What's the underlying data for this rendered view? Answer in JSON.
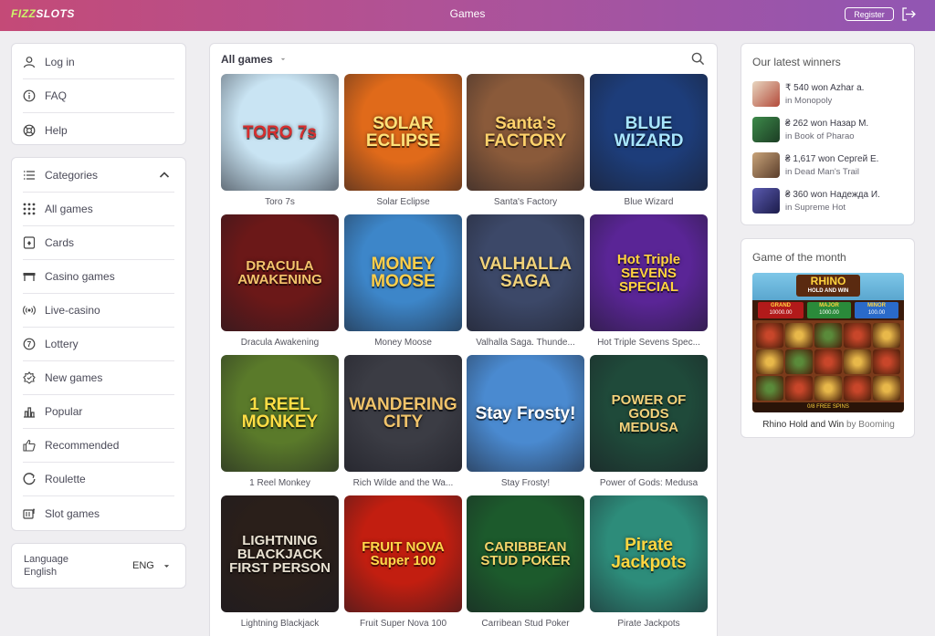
{
  "header": {
    "logo_part1": "FIZZ",
    "logo_part2": "SLOTS",
    "title": "Games",
    "register_label": "Register",
    "exit_icon": "exit-icon"
  },
  "account_menu": [
    {
      "label": "Log in",
      "icon": "user-icon"
    },
    {
      "label": "FAQ",
      "icon": "info-icon"
    },
    {
      "label": "Help",
      "icon": "lifebuoy-icon"
    }
  ],
  "categories": {
    "header": "Categories",
    "items": [
      {
        "label": "All games",
        "icon": "grid-icon"
      },
      {
        "label": "Cards",
        "icon": "card-icon"
      },
      {
        "label": "Casino games",
        "icon": "table-icon"
      },
      {
        "label": "Live-casino",
        "icon": "broadcast-icon"
      },
      {
        "label": "Lottery",
        "icon": "lottery-icon"
      },
      {
        "label": "New games",
        "icon": "badge-icon"
      },
      {
        "label": "Popular",
        "icon": "chart-icon"
      },
      {
        "label": "Recommended",
        "icon": "thumb-up-icon"
      },
      {
        "label": "Roulette",
        "icon": "roulette-icon"
      },
      {
        "label": "Slot games",
        "icon": "slot-icon"
      }
    ]
  },
  "language": {
    "label": "Language",
    "value": "English",
    "code": "ENG"
  },
  "games": {
    "filter_label": "All games",
    "tiles": [
      {
        "name": "Toro 7s",
        "art": "TORO 7s",
        "bg": "#c9e4f3",
        "fg": "#d62e2e"
      },
      {
        "name": "Solar Eclipse",
        "art": "SOLAR ECLIPSE",
        "bg": "#e06a1a",
        "fg": "#ffe27a"
      },
      {
        "name": "Santa's Factory",
        "art": "Santa's FACTORY",
        "bg": "#8a5a3a",
        "fg": "#ffd26b"
      },
      {
        "name": "Blue Wizard",
        "art": "BLUE WIZARD",
        "bg": "#1d3d7a",
        "fg": "#a8e6ff"
      },
      {
        "name": "Dracula Awakening",
        "art": "DRACULA AWAKENING",
        "bg": "#6b1818",
        "fg": "#f3c46c"
      },
      {
        "name": "Money Moose",
        "art": "MONEY MOOSE",
        "bg": "#3d86c9",
        "fg": "#ffcf4a"
      },
      {
        "name": "Valhalla Saga. Thunde...",
        "art": "VALHALLA SAGA",
        "bg": "#3c4868",
        "fg": "#f1d27a"
      },
      {
        "name": "Hot Triple Sevens Spec...",
        "art": "Hot Triple SEVENS SPECIAL",
        "bg": "#5a2596",
        "fg": "#ffd33d"
      },
      {
        "name": "1 Reel Monkey",
        "art": "1 REEL MONKEY",
        "bg": "#5a7a2a",
        "fg": "#ffdd44"
      },
      {
        "name": "Rich Wilde and the Wa...",
        "art": "WANDERING CITY",
        "bg": "#3b3c44",
        "fg": "#f0c36a"
      },
      {
        "name": "Stay Frosty!",
        "art": "Stay Frosty!",
        "bg": "#4a8ad0",
        "fg": "#ffffff"
      },
      {
        "name": "Power of Gods: Medusa",
        "art": "POWER OF GODS MEDUSA",
        "bg": "#1f4a3a",
        "fg": "#f3d07a"
      },
      {
        "name": "Lightning Blackjack",
        "art": "LIGHTNING BLACKJACK FIRST PERSON",
        "bg": "#2a1f1a",
        "fg": "#e9e2d2"
      },
      {
        "name": "Fruit Super Nova 100",
        "art": "FRUIT NOVA Super 100",
        "bg": "#c21e10",
        "fg": "#ffd94a"
      },
      {
        "name": "Carribean Stud Poker",
        "art": "CARIBBEAN STUD POKER",
        "bg": "#1c5a2c",
        "fg": "#f4d36a"
      },
      {
        "name": "Pirate Jackpots",
        "art": "Pirate Jackpots",
        "bg": "#2d8c7a",
        "fg": "#ffd640"
      }
    ]
  },
  "winners": {
    "title": "Our latest winners",
    "items": [
      {
        "amount": "₹ 540 won Azhar a.",
        "game": "in Monopoly",
        "thumb": "#b34a3a"
      },
      {
        "amount": "₴ 262 won Назар М.",
        "game": "in Book of Pharao",
        "thumb": "#2c6a3a"
      },
      {
        "amount": "₴ 1,617 won Сергей Е.",
        "game": "in Dead Man's Trail",
        "thumb": "#8a6a4a"
      },
      {
        "amount": "₴ 360 won Надежда И.",
        "game": "in Supreme Hot",
        "thumb": "#3a3a7a"
      }
    ]
  },
  "game_of_month": {
    "title": "Game of the month",
    "art_title": "RHINO",
    "art_sub": "HOLD AND WIN",
    "game_name": "Rhino Hold and Win",
    "by_text": "by Booming",
    "grand": "GRAND",
    "grand_value": "10000.00",
    "major": "MAJOR",
    "major_value": "1000.00",
    "minor": "MINOR",
    "minor_value": "100.00",
    "free_spins": "0/8 FREE SPINS"
  }
}
